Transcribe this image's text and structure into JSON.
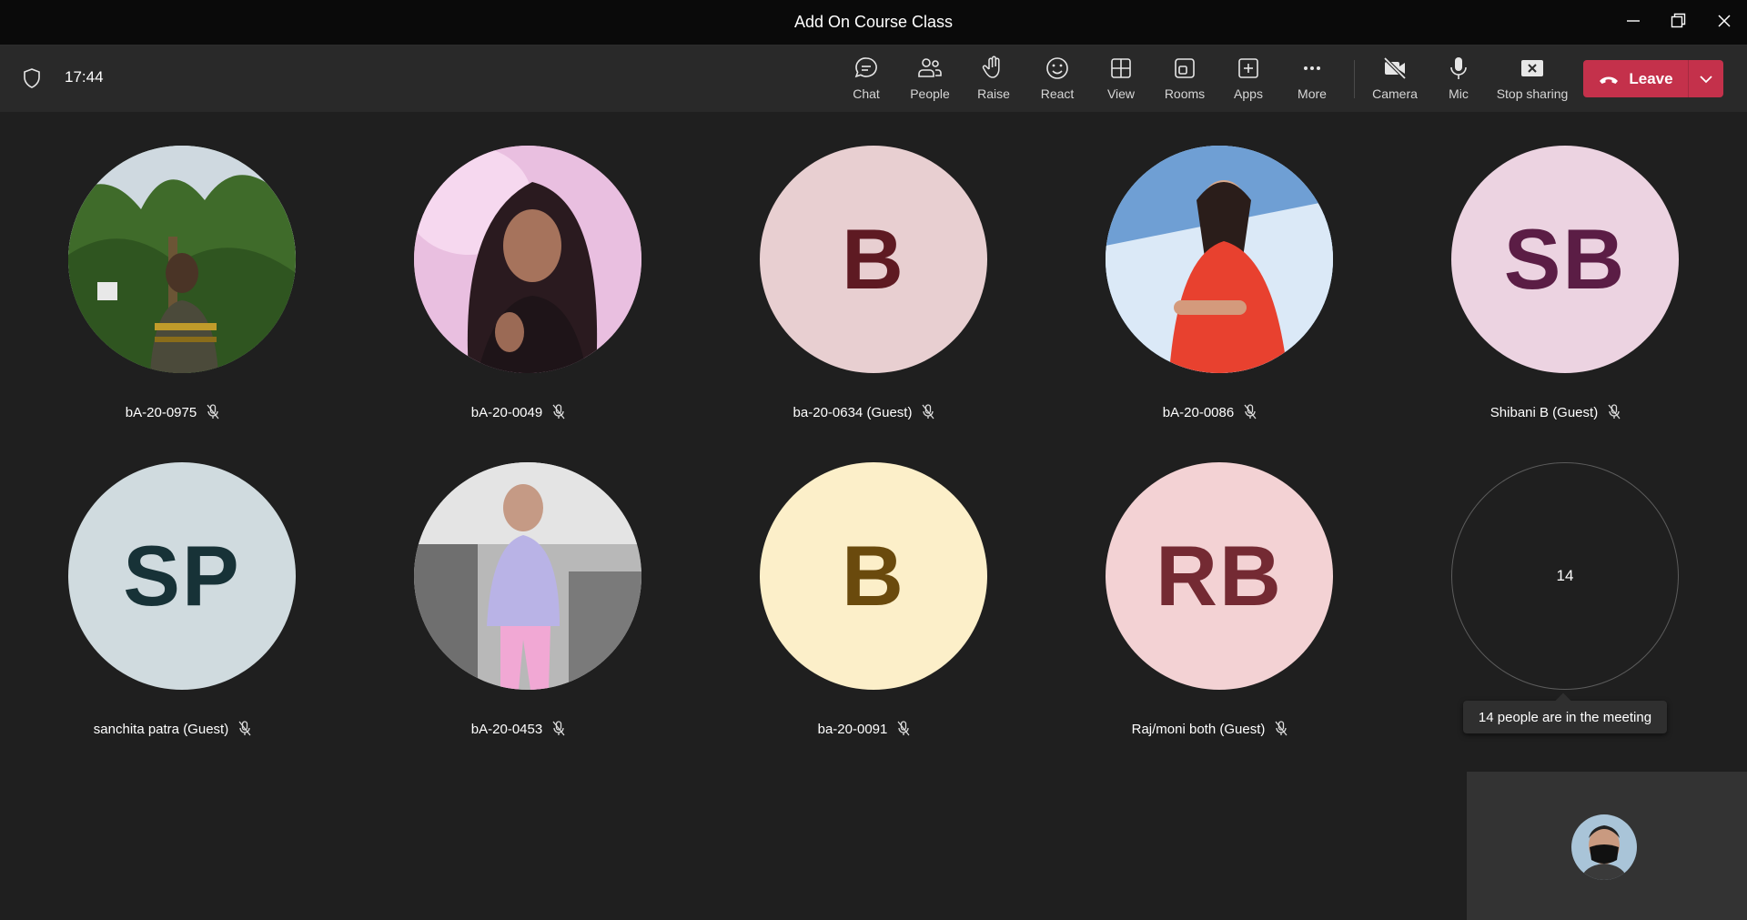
{
  "window": {
    "title": "Add On Course Class",
    "controls": [
      "minimize-icon",
      "restore-icon",
      "close-icon"
    ]
  },
  "toolbar": {
    "time": "17:44",
    "buttons": {
      "chat": "Chat",
      "people": "People",
      "raise": "Raise",
      "react": "React",
      "view": "View",
      "rooms": "Rooms",
      "apps": "Apps",
      "more": "More",
      "camera": "Camera",
      "mic": "Mic",
      "stop_sharing": "Stop sharing"
    },
    "leave_label": "Leave"
  },
  "participants": [
    {
      "name": "bA-20-0975",
      "type": "photo",
      "muted": true
    },
    {
      "name": "bA-20-0049",
      "type": "photo",
      "muted": true
    },
    {
      "name": "ba-20-0634 (Guest)",
      "type": "initials",
      "initials": "B",
      "bg": "#e8cfd1",
      "fg": "#5e1a22",
      "muted": true
    },
    {
      "name": "bA-20-0086",
      "type": "photo",
      "muted": true
    },
    {
      "name": "Shibani B (Guest)",
      "type": "initials",
      "initials": "SB",
      "bg": "#ecd3e1",
      "fg": "#5b1d45",
      "muted": true
    },
    {
      "name": "sanchita patra (Guest)",
      "type": "initials",
      "initials": "SP",
      "bg": "#d0dbdf",
      "fg": "#173237",
      "muted": true
    },
    {
      "name": "bA-20-0453",
      "type": "photo",
      "muted": true
    },
    {
      "name": "ba-20-0091",
      "type": "initials",
      "initials": "B",
      "bg": "#fcefc9",
      "fg": "#6a4a0d",
      "muted": true
    },
    {
      "name": "Raj/moni both (Guest)",
      "type": "initials",
      "initials": "RB",
      "bg": "#f3d2d4",
      "fg": "#742a33",
      "muted": true
    }
  ],
  "overflow": {
    "count": "14",
    "tooltip": "14 people are in the meeting"
  },
  "colors": {
    "leave": "#c4314b",
    "background": "#1f1f1f",
    "toolbar": "#292929"
  }
}
